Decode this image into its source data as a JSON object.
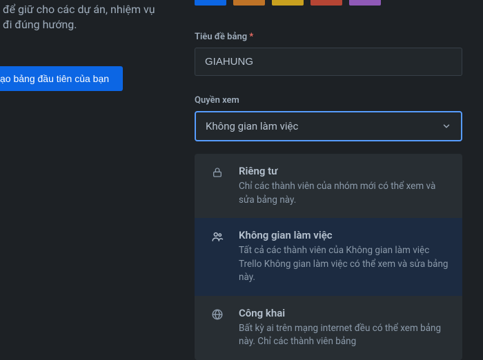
{
  "left": {
    "description": "để giữ cho các dự án, nhiệm vụ đi đúng hướng.",
    "create_btn": "ạo bảng đầu tiên của bạn"
  },
  "swatches": [
    "#0c66e4",
    "#bf7327",
    "#c9a11f",
    "#b54534",
    "#8f59b7"
  ],
  "title_label": "Tiêu đề bảng",
  "title_value": "GIAHUNG",
  "visibility_label": "Quyền xem",
  "selected_visibility": "Không gian làm việc",
  "options": {
    "private": {
      "title": "Riêng tư",
      "desc": "Chỉ các thành viên của nhóm mới có thể xem và sửa bảng này."
    },
    "workspace": {
      "title": "Không gian làm việc",
      "desc": "Tất cả các thành viên của Không gian làm việc Trello Không gian làm việc có thể xem và sửa bảng này."
    },
    "public": {
      "title": "Công khai",
      "desc": "Bất kỳ ai trên mạng internet đều có thể xem bảng này. Chỉ các thành viên bảng"
    }
  }
}
